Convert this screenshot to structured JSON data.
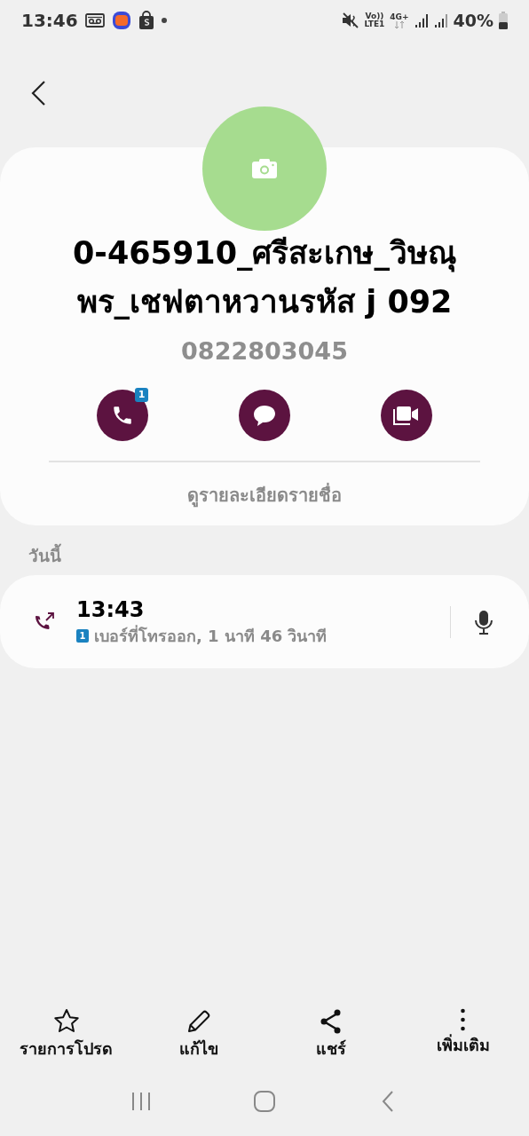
{
  "status_bar": {
    "time": "13:46",
    "volte": "Vo))",
    "lte": "LTE1",
    "network": "4G+",
    "battery": "40%"
  },
  "contact": {
    "name_lines": [
      "0-465910_ศรีสะเกษ_วิษณุ",
      "พร_เชฟตาหวานรหัส j 092"
    ],
    "number": "0822803045",
    "actions": [
      {
        "kind": "call",
        "badge": "1"
      },
      {
        "kind": "message"
      },
      {
        "kind": "video"
      }
    ],
    "details_link": "ดูรายละเอียดรายชื่อ"
  },
  "history": {
    "heading": "วันนี้",
    "calls": [
      {
        "time": "13:43",
        "sim": "1",
        "description": "เบอร์ที่โทรออก, 1 นาที 46 วินาที"
      }
    ]
  },
  "bottom_actions": [
    {
      "kind": "favorite",
      "label": "รายการโปรด"
    },
    {
      "kind": "edit",
      "label": "แก้ไข"
    },
    {
      "kind": "share",
      "label": "แชร์"
    },
    {
      "kind": "more",
      "label": "เพิ่มเติม"
    }
  ]
}
